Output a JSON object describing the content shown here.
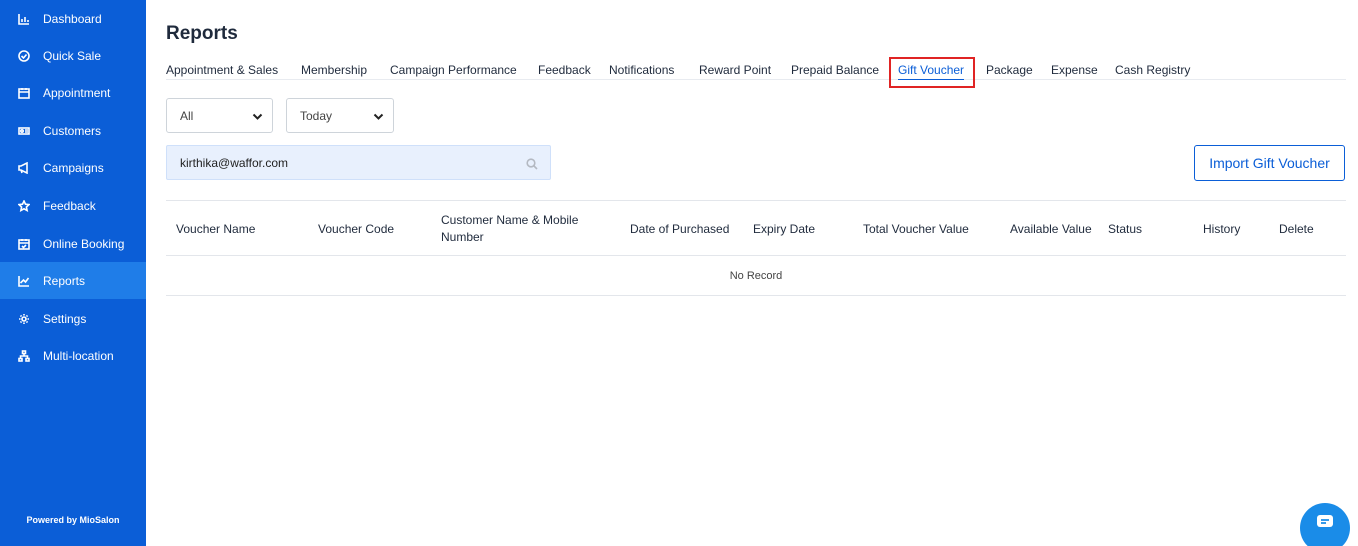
{
  "sidebar": {
    "items": [
      {
        "label": "Dashboard",
        "icon": "chart-bar-icon"
      },
      {
        "label": "Quick Sale",
        "icon": "check-circle-icon"
      },
      {
        "label": "Appointment",
        "icon": "calendar-icon"
      },
      {
        "label": "Customers",
        "icon": "users-icon"
      },
      {
        "label": "Campaigns",
        "icon": "megaphone-icon"
      },
      {
        "label": "Feedback",
        "icon": "star-icon"
      },
      {
        "label": "Online Booking",
        "icon": "calendar-check-icon"
      },
      {
        "label": "Reports",
        "icon": "line-chart-icon"
      },
      {
        "label": "Settings",
        "icon": "gear-icon"
      },
      {
        "label": "Multi-location",
        "icon": "sitemap-icon"
      }
    ],
    "active": "Reports",
    "footer": "Powered by MioSalon"
  },
  "page": {
    "title": "Reports"
  },
  "tabs": [
    "Appointment & Sales",
    "Membership",
    "Campaign Performance",
    "Feedback",
    "Notifications",
    "Reward Point",
    "Prepaid Balance",
    "Gift Voucher",
    "Package",
    "Expense",
    "Cash Registry"
  ],
  "active_tab": "Gift Voucher",
  "filters": {
    "type_select": "All",
    "date_select": "Today"
  },
  "search": {
    "value": "kirthika@waffor.com"
  },
  "import_button": "Import Gift Voucher",
  "table": {
    "columns": [
      "Voucher Name",
      "Voucher Code",
      "Customer Name & Mobile Number",
      "Date of Purchased",
      "Expiry Date",
      "Total Voucher Value",
      "Available Value",
      "Status",
      "History",
      "Delete"
    ],
    "empty_message": "No Record"
  },
  "colors": {
    "sidebar": "#0b5ed7",
    "sidebar_active": "#1f7de8",
    "accent": "#0b5ed7",
    "highlight": "#e02424"
  }
}
